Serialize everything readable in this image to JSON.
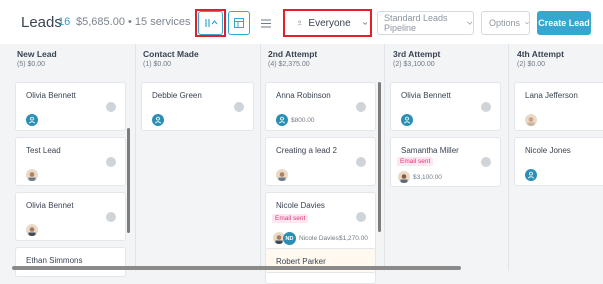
{
  "header": {
    "title": "Leads",
    "count": "16",
    "summary": "$5,685.00 • 15 services",
    "filter_label": "Everyone",
    "pipeline_label": "Standard Leads Pipeline",
    "options_label": "Options",
    "create_label": "Create Lead",
    "accent": "#35a7d0",
    "highlight": "#e3202a"
  },
  "columns": [
    {
      "name": "New Lead",
      "sub": "(5) $0.00",
      "cards": [
        {
          "name": "Olivia Bennett",
          "avatar": "user-icon"
        },
        {
          "name": "Test Lead",
          "avatar": "photo"
        },
        {
          "name": "Olivia Bennet",
          "avatar": "photo"
        },
        {
          "name": "Ethan Simmons"
        }
      ]
    },
    {
      "name": "Contact Made",
      "sub": "(1) $0.00",
      "cards": [
        {
          "name": "Debbie Green",
          "avatar": "user-icon"
        }
      ]
    },
    {
      "name": "2nd Attempt",
      "sub": "(4) $2,375.00",
      "cards": [
        {
          "name": "Anna Robinson",
          "avatar": "user-icon",
          "amount": "$800.00"
        },
        {
          "name": "Creating a lead 2",
          "avatar": "photo"
        },
        {
          "name": "Nicole Davies",
          "badge": "Email sent",
          "initials": "ND",
          "owner": "Nicole Davies",
          "amount": "$1,270.00"
        },
        {
          "name": "Robert Parker"
        }
      ]
    },
    {
      "name": "3rd Attempt",
      "sub": "(2) $3,100.00",
      "cards": [
        {
          "name": "Olivia Bennett",
          "avatar": "user-icon"
        },
        {
          "name": "Samantha Miller",
          "badge": "Email sent",
          "avatar": "photo",
          "amount": "$3,100.00"
        }
      ]
    },
    {
      "name": "4th Attempt",
      "sub": "(2) $0.00",
      "cards": [
        {
          "name": "Lana Jefferson",
          "avatar": "photo"
        },
        {
          "name": "Nicole Jones",
          "avatar": "user-icon"
        }
      ]
    }
  ]
}
